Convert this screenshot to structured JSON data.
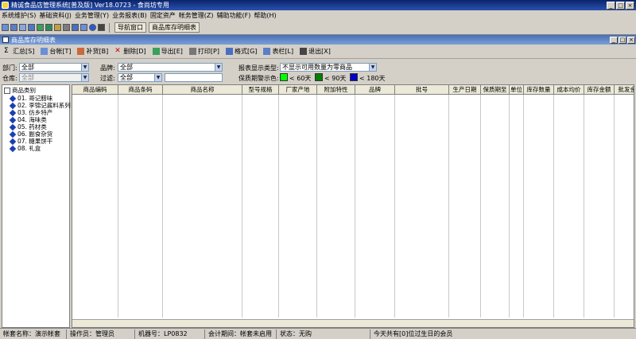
{
  "app": {
    "title": "精诚食品店管理系统[普及版] Ver18.0723  -  食尚坊专用"
  },
  "window_buttons": {
    "minimize": "_",
    "maximize": "□",
    "close": "×"
  },
  "menubar": [
    "系统维护(S)",
    "基础资料(J)",
    "业务管理(Y)",
    "业务报表(B)",
    "固定资产",
    "帐务管理(Z)",
    "辅助功能(F)",
    "帮助(H)"
  ],
  "toolbar1": {
    "buttons": [
      "导航窗口",
      "商品库存明细表"
    ]
  },
  "child": {
    "title": "商品库存明细表"
  },
  "toolbar2": [
    "汇总[S]",
    "台帐[T]",
    "补货[B]",
    "删除[D]",
    "导出[E]",
    "打印[P]",
    "格式[G]",
    "表栏[L]",
    "退出[X]"
  ],
  "filters": {
    "dept_label": "部门:",
    "dept_value": "全部",
    "warehouse_label": "仓库:",
    "warehouse_value": "全部",
    "brand_label": "品牌:",
    "brand_value": "全部",
    "filter_label": "过滤:",
    "filter_value": "全部",
    "report_type_label": "报表显示类型:",
    "report_type_value": "不显示可用数量为零商品",
    "shelf_label": "保质期警示色:",
    "legend": [
      {
        "text": "< 60天",
        "color": "#00ff00"
      },
      {
        "text": "< 90天",
        "color": "#008000"
      },
      {
        "text": "< 180天",
        "color": "#0000c8"
      }
    ]
  },
  "tree": {
    "root": "商品类别",
    "items": [
      "01. 哥记腊味",
      "02. 李锦记酱料系列",
      "03. 仿乡特产",
      "04. 海味类",
      "05. 药材类",
      "06. 副食杂货",
      "07. 糖果饼干",
      "08. 礼盒"
    ]
  },
  "grid": {
    "columns": [
      "商品编码",
      "商品条码",
      "商品名称",
      "型号规格",
      "厂家产地",
      "附加特性",
      "品牌",
      "批号",
      "生产日期",
      "保质期至",
      "单位",
      "库存数量",
      "成本均价",
      "库存金额",
      "批发金额"
    ]
  },
  "statusbar": {
    "account": "帐套名称：演示帐套",
    "operator": "操作员：管理员",
    "machine": "机器号：LP0832",
    "period": "会计期间：帐套未启用",
    "state": "状态：无购",
    "birthday": "今天共有[0]位过生日的会员"
  }
}
